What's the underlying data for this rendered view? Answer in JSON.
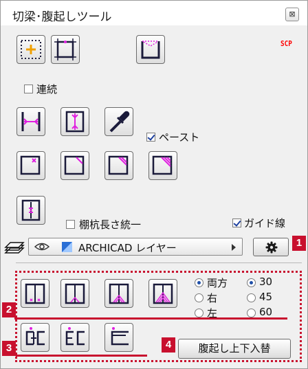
{
  "window": {
    "title": "切梁･腹起しツール",
    "close_glyph": "⊠"
  },
  "scp_label": "SCP",
  "options": {
    "continuous_label": "連続",
    "continuous_checked": false,
    "paste_label": "ペースト",
    "paste_checked": true,
    "unify_length_label": "棚杭長さ統一",
    "unify_length_checked": false,
    "guide_label": "ガイド線",
    "guide_checked": true
  },
  "layer": {
    "name": "ARCHICAD レイヤー"
  },
  "badges": {
    "b1": "1",
    "b2": "2",
    "b3": "3",
    "b4": "4"
  },
  "radios": {
    "side": [
      {
        "label": "両方",
        "selected": true
      },
      {
        "label": "右",
        "selected": false
      },
      {
        "label": "左",
        "selected": false
      }
    ],
    "angle": [
      {
        "label": "30",
        "selected": true
      },
      {
        "label": "45",
        "selected": false
      },
      {
        "label": "60",
        "selected": false
      }
    ]
  },
  "swap_button_label": "腹起し上下入替",
  "colors": {
    "accent_magenta": "#e020e0",
    "badge_red": "#c8102e",
    "dark_navy": "#1a1a3a"
  }
}
